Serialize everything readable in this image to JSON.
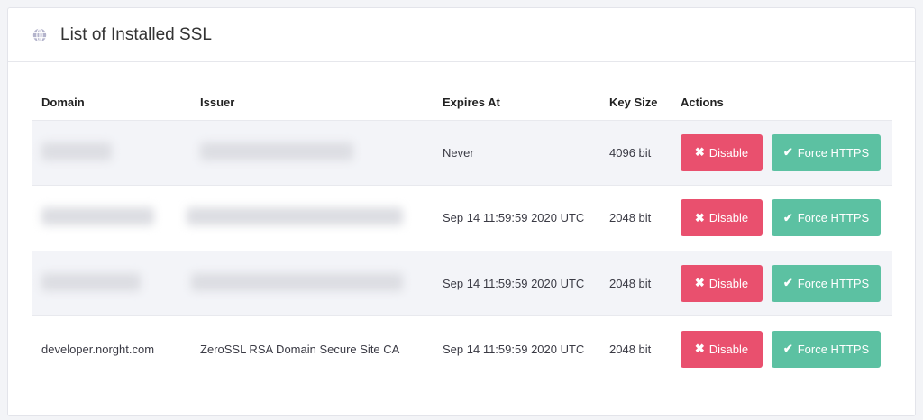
{
  "header": {
    "title": "List of Installed SSL",
    "icon": "globe-icon"
  },
  "table": {
    "columns": [
      "Domain",
      "Issuer",
      "Expires At",
      "Key Size",
      "Actions"
    ],
    "rows": [
      {
        "domain": null,
        "issuer": null,
        "expires": "Never",
        "key_size": "4096 bit"
      },
      {
        "domain": null,
        "issuer": null,
        "expires": "Sep 14 11:59:59 2020 UTC",
        "key_size": "2048 bit"
      },
      {
        "domain": null,
        "issuer": null,
        "expires": "Sep 14 11:59:59 2020 UTC",
        "key_size": "2048 bit"
      },
      {
        "domain": "developer.norght.com",
        "issuer": "ZeroSSL RSA Domain Secure Site CA",
        "expires": "Sep 14 11:59:59 2020 UTC",
        "key_size": "2048 bit"
      }
    ],
    "disable_label": "Disable",
    "force_label": "Force HTTPS"
  },
  "colors": {
    "disable": "#e9506e",
    "force": "#5cc1a2"
  }
}
